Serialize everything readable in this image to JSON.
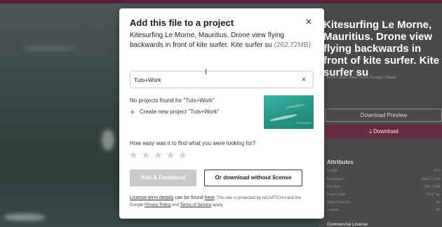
{
  "background": {
    "title": "Kitesurfing Le Morne, Mauritius. Drone view flying backwards in front of kite surfer. Kite surfer su",
    "breadcrumb": "Items / Stock Video / Stock Footage / Nature",
    "download_preview_label": "Download Preview",
    "download_label": "Download",
    "attributes_title": "Attributes",
    "attributes": [
      {
        "label": "Length",
        "value": "0:15"
      },
      {
        "label": "Resolution",
        "value": "3840 x 2160"
      },
      {
        "label": "File Size",
        "value": "262.72MB"
      },
      {
        "label": "Frame Rate",
        "value": "29.97 fps"
      },
      {
        "label": "Alpha Channel",
        "value": "No"
      },
      {
        "label": "Looped",
        "value": "No"
      }
    ],
    "commercial_label": "Commercial License"
  },
  "modal": {
    "title": "Add this file to a project",
    "close_icon": "close-icon",
    "file_description": "Kitesurfing Le Morne, Mauritius. Drone view flying backwards in front of kite surfer. Kite surfer su",
    "file_size": "(262.72MB)",
    "search": {
      "value": "Tuts+Work",
      "clear_icon": "clear-icon"
    },
    "no_projects_text": "No projects found for \"Tuts+Work\"",
    "create_new_label": "Create new project \"Tuts+Work\"",
    "ease_question": "How easy was it to find what you were looking for?",
    "star_count": 5,
    "add_download_label": "Add & Download",
    "no_license_label": "Or download without license",
    "license_prefix": "License term details",
    "license_mid": " can be found ",
    "license_here": "here",
    "license_rest": ". This site is protected by reCAPTCHA and the Google ",
    "privacy_label": "Privacy Policy",
    "and_text": " and ",
    "terms_label": "Terms of Service",
    "apply_text": " apply."
  },
  "colors": {
    "accent_bg_download": "#6b2a44",
    "disabled_button": "#c9c9c9"
  }
}
